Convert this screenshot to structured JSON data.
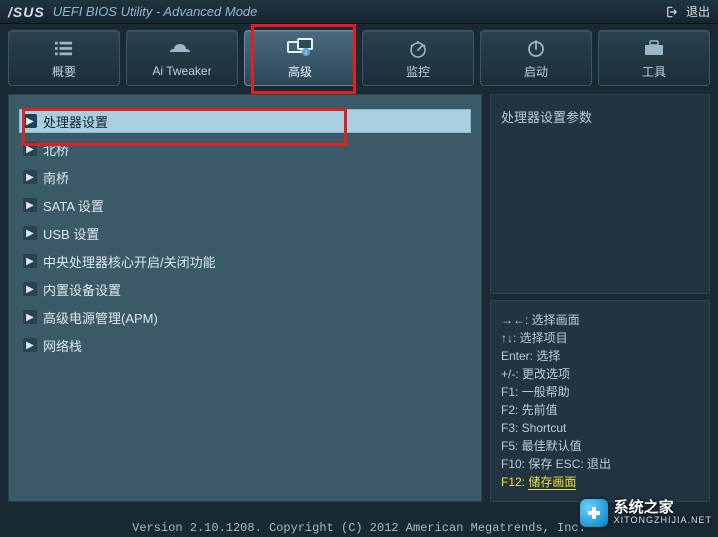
{
  "title": {
    "brand": "/SUS",
    "text": "UEFI BIOS Utility - Advanced Mode",
    "exit_label": "退出"
  },
  "tabs": [
    {
      "label": "概要",
      "icon": "list"
    },
    {
      "label": "Ai Tweaker",
      "icon": "tweaker"
    },
    {
      "label": "高级",
      "icon": "advanced",
      "active": true
    },
    {
      "label": "监控",
      "icon": "monitor"
    },
    {
      "label": "启动",
      "icon": "power"
    },
    {
      "label": "工具",
      "icon": "tool"
    }
  ],
  "menu": [
    {
      "label": "处理器设置",
      "selected": true
    },
    {
      "label": "北桥"
    },
    {
      "label": "南桥"
    },
    {
      "label": "SATA 设置"
    },
    {
      "label": "USB 设置"
    },
    {
      "label": "中央处理器核心开启/关闭功能"
    },
    {
      "label": "内置设备设置"
    },
    {
      "label": "高级电源管理(APM)"
    },
    {
      "label": "网络栈"
    }
  ],
  "info_panel": "处理器设置参数",
  "help": {
    "l0": "→←: 选择画面",
    "l1": "↑↓: 选择项目",
    "l2": "Enter: 选择",
    "l3": "+/-: 更改选项",
    "l4": "F1: 一般帮助",
    "l5": "F2: 先前值",
    "l6": "F3: Shortcut",
    "l7": "F5: 最佳默认值",
    "l8": "F10: 保存  ESC: 退出",
    "l9a": "F12: ",
    "l9b": "储存画面"
  },
  "footer": "Version 2.10.1208. Copyright (C) 2012 American Megatrends, Inc.",
  "watermark": {
    "name": "系统之家",
    "url": "XITONGZHIJIA.NET"
  }
}
